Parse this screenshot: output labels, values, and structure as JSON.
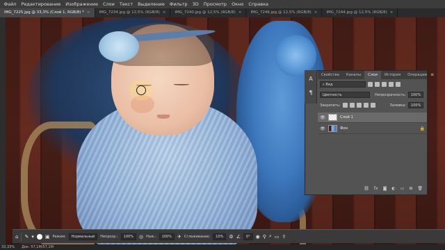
{
  "menu": [
    "Файл",
    "Редактирование",
    "Изображение",
    "Слои",
    "Текст",
    "Выделение",
    "Фильтр",
    "3D",
    "Просмотр",
    "Окно",
    "Справка"
  ],
  "tabs": [
    {
      "label": "IMG_7225.jpg @ 33,3% (Слой 1, RGB/8) *",
      "active": true
    },
    {
      "label": "IMG_7234.jpg @ 12,5% (RGB/8)",
      "active": false
    },
    {
      "label": "IMG_7240.jpg @ 12,5% (RGB/8)",
      "active": false
    },
    {
      "label": "IMG_7246.jpg @ 12,5% (RGB/8)",
      "active": false
    },
    {
      "label": "IMG_7244.jpg @ 12,5% (RGB/8)",
      "active": false
    }
  ],
  "tab_close": "×",
  "panel": {
    "tabs": [
      "Свойства",
      "Каналы",
      "Слои",
      "История",
      "Операции"
    ],
    "active_tab": "Слои",
    "menu_icon": "≡",
    "filter_label": "Вид",
    "blend_mode": "Цветность",
    "opacity_label": "Непрозрачность:",
    "opacity_value": "100%",
    "lock_label": "Закрепить:",
    "fill_label": "Заливка:",
    "fill_value": "100%",
    "layers": [
      {
        "name": "Слой 1",
        "selected": true,
        "thumb": "transparent"
      },
      {
        "name": "Фон",
        "selected": false,
        "thumb": "photo",
        "locked": true
      }
    ],
    "footer_icons": [
      "link-icon",
      "fx-icon",
      "mask-icon",
      "adjustment-icon",
      "folder-icon",
      "new-layer-icon",
      "trash-icon"
    ]
  },
  "options": {
    "mode_label": "Режим:",
    "mode_value": "Нормальный",
    "opacity_label": "Непрозр.:",
    "opacity_value": "100%",
    "pressure_label": "Наж.:",
    "pressure_value": "100%",
    "smoothing_label": "Сглаживание:",
    "smoothing_value": "10%",
    "angle_value": "0°"
  },
  "status": {
    "zoom": "33,33%",
    "doc": "Док: 57,1M/57,1M"
  },
  "colors": {
    "accent": "#3d78bd",
    "panel_bg": "#535353",
    "menubar_bg": "#3c3c3c"
  }
}
